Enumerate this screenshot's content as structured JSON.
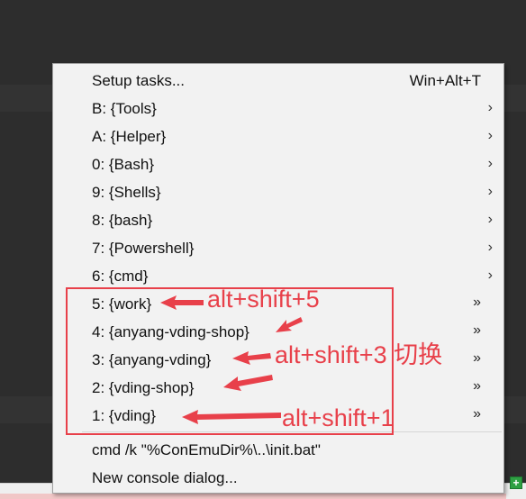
{
  "menu": {
    "items": [
      {
        "label": "Setup tasks...",
        "shortcut": "Win+Alt+T",
        "submenu": "none"
      },
      {
        "label": "B: {Tools}",
        "shortcut": "",
        "submenu": "arrow"
      },
      {
        "label": "A: {Helper}",
        "shortcut": "",
        "submenu": "arrow"
      },
      {
        "label": "0: {Bash}",
        "shortcut": "",
        "submenu": "arrow"
      },
      {
        "label": "9: {Shells}",
        "shortcut": "",
        "submenu": "arrow"
      },
      {
        "label": "8: {bash}",
        "shortcut": "",
        "submenu": "arrow"
      },
      {
        "label": "7: {Powershell}",
        "shortcut": "",
        "submenu": "arrow"
      },
      {
        "label": "6: {cmd}",
        "shortcut": "",
        "submenu": "arrow"
      },
      {
        "label": "5: {work}",
        "shortcut": "",
        "submenu": "double"
      },
      {
        "label": "4: {anyang-vding-shop}",
        "shortcut": "",
        "submenu": "double"
      },
      {
        "label": "3: {anyang-vding}",
        "shortcut": "",
        "submenu": "double"
      },
      {
        "label": "2: {vding-shop}",
        "shortcut": "",
        "submenu": "double"
      },
      {
        "label": "1: {vding}",
        "shortcut": "",
        "submenu": "double"
      },
      {
        "label": "cmd /k \"%ConEmuDir%\\..\\init.bat\"",
        "shortcut": "",
        "submenu": "none"
      },
      {
        "label": "New console dialog...",
        "shortcut": "",
        "submenu": "none"
      }
    ],
    "arrow_glyph": "›",
    "double_glyph": "»"
  },
  "annotations": {
    "note_1": "alt+shift+5",
    "note_2": "alt+shift+3 切换",
    "note_3": "alt+shift+1",
    "color": "#e8404a"
  },
  "status": {
    "add_icon_glyph": "+",
    "add_icon_color": "#2ea043"
  }
}
